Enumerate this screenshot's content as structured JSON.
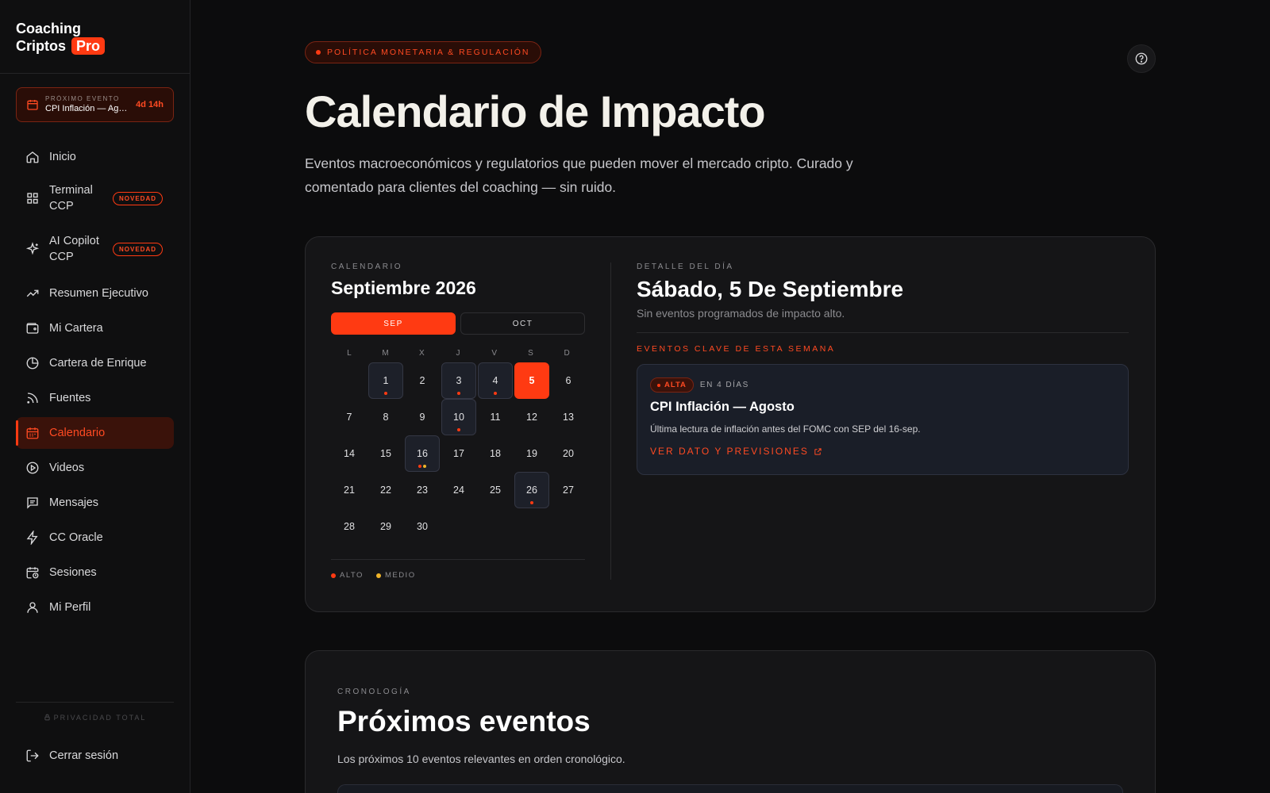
{
  "brand": {
    "name_line1": "Coaching",
    "name_line2": "Criptos",
    "pro": "Pro"
  },
  "next_event": {
    "kicker": "PRÓXIMO EVENTO",
    "name": "CPI Inflación — Agosto",
    "countdown": "4d 14h"
  },
  "nav": [
    {
      "label": "Inicio",
      "icon": "home-icon"
    },
    {
      "label": "Terminal CCP",
      "icon": "grid-icon",
      "badge": "NOVEDAD"
    },
    {
      "label": "AI Copilot CCP",
      "icon": "sparkles-icon",
      "badge": "NOVEDAD"
    },
    {
      "label": "Resumen Ejecutivo",
      "icon": "trending-up-icon"
    },
    {
      "label": "Mi Cartera",
      "icon": "wallet-icon"
    },
    {
      "label": "Cartera de Enrique",
      "icon": "pie-chart-icon"
    },
    {
      "label": "Fuentes",
      "icon": "rss-icon"
    },
    {
      "label": "Calendario",
      "icon": "calendar-icon",
      "active": true
    },
    {
      "label": "Videos",
      "icon": "play-circle-icon"
    },
    {
      "label": "Mensajes",
      "icon": "message-icon"
    },
    {
      "label": "CC Oracle",
      "icon": "zap-icon"
    },
    {
      "label": "Sesiones",
      "icon": "calendar-clock-icon"
    },
    {
      "label": "Mi Perfil",
      "icon": "user-icon"
    }
  ],
  "privacy": "PRIVACIDAD TOTAL",
  "logout": "Cerrar sesión",
  "header": {
    "category": "POLÍTICA MONETARIA & REGULACIÓN",
    "title": "Calendario de Impacto",
    "subtitle": "Eventos macroeconómicos y regulatorios que pueden mover el mercado cripto. Curado y comentado para clientes del coaching — sin ruido."
  },
  "calendar": {
    "kicker": "CALENDARIO",
    "month": "Septiembre 2026",
    "tabs": [
      "SEP",
      "OCT"
    ],
    "active_tab": 0,
    "weekdays": [
      "L",
      "M",
      "X",
      "J",
      "V",
      "S",
      "D"
    ],
    "first_offset": 1,
    "days_in_month": 30,
    "selected_day": 5,
    "events": {
      "1": [
        "alto"
      ],
      "3": [
        "alto"
      ],
      "4": [
        "alto"
      ],
      "10": [
        "alto"
      ],
      "16": [
        "alto",
        "medio"
      ],
      "26": [
        "alto"
      ]
    },
    "colors": {
      "alto": "#ff3a12",
      "medio": "#f0b429"
    },
    "legend": [
      {
        "key": "alto",
        "label": "ALTO"
      },
      {
        "key": "medio",
        "label": "MEDIO"
      }
    ]
  },
  "detail": {
    "kicker": "DETALLE DEL DÍA",
    "title": "Sábado, 5 De Septiembre",
    "empty": "Sin eventos programados de impacto alto.",
    "week_title": "EVENTOS CLAVE DE ESTA SEMANA",
    "event": {
      "impact": "ALTA",
      "when": "EN 4 DÍAS",
      "title": "CPI Inflación — Agosto",
      "description": "Última lectura de inflación antes del FOMC con SEP del 16-sep.",
      "link": "VER DATO Y PREVISIONES"
    }
  },
  "upcoming": {
    "kicker": "CRONOLOGÍA",
    "title": "Próximos eventos",
    "subtitle": "Los próximos 10 eventos relevantes en orden cronológico."
  }
}
